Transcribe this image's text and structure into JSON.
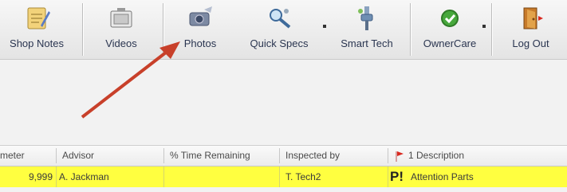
{
  "toolbar": {
    "buttons": [
      {
        "label": "Shop Notes",
        "icon": "notepad-pencil-icon"
      },
      {
        "label": "Videos",
        "icon": "video-camera-icon"
      },
      {
        "label": "Photos",
        "icon": "camera-icon"
      },
      {
        "label": "Quick Specs",
        "icon": "wrench-magnifier-icon"
      },
      {
        "label": "Smart Tech",
        "icon": "tech-tool-icon"
      },
      {
        "label": "OwnerCare",
        "icon": "green-check-icon"
      },
      {
        "label": "Log Out",
        "icon": "exit-door-icon"
      }
    ]
  },
  "grid": {
    "columns": [
      "meter",
      "Advisor",
      "% Time Remaining",
      "Inspected by",
      "1 Description"
    ],
    "rows": [
      {
        "meter": "9,999",
        "advisor": "A. Jackman",
        "time_remaining": "",
        "inspected_by": "T. Tech2",
        "flag": "P!",
        "description": "Attention Parts"
      }
    ]
  },
  "colors": {
    "row_highlight": "#ffff40",
    "arrow": "#c8402a",
    "flag_red": "#d9281f"
  }
}
